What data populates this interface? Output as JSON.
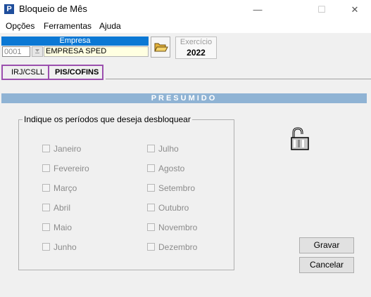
{
  "window": {
    "title": "Bloqueio de Mês",
    "app_icon_letter": "P",
    "minimize": "—",
    "maximize": "☐",
    "close": "✕"
  },
  "menu": [
    "Opções",
    "Ferramentas",
    "Ajuda"
  ],
  "empresa": {
    "label": "Empresa",
    "code": "0001",
    "name": "EMPRESA SPED"
  },
  "exercicio": {
    "label": "Exercício",
    "value": "2022"
  },
  "tabs": [
    {
      "label": "IRJ/CSLL",
      "active": false
    },
    {
      "label": "PIS/COFINS",
      "active": true
    }
  ],
  "section_title": "PRESUMIDO",
  "group": {
    "legend": "Indique os períodos que deseja desbloquear",
    "months_left": [
      "Janeiro",
      "Fevereiro",
      "Março",
      "Abril",
      "Maio",
      "Junho"
    ],
    "months_right": [
      "Julho",
      "Agosto",
      "Setembro",
      "Outubro",
      "Novembro",
      "Dezembro"
    ]
  },
  "buttons": {
    "save": "Gravar",
    "cancel": "Cancelar"
  },
  "colors": {
    "empresa_header": "#0b78d4",
    "section_band": "#8fb3d4",
    "tab_highlight": "#9b4fae"
  }
}
